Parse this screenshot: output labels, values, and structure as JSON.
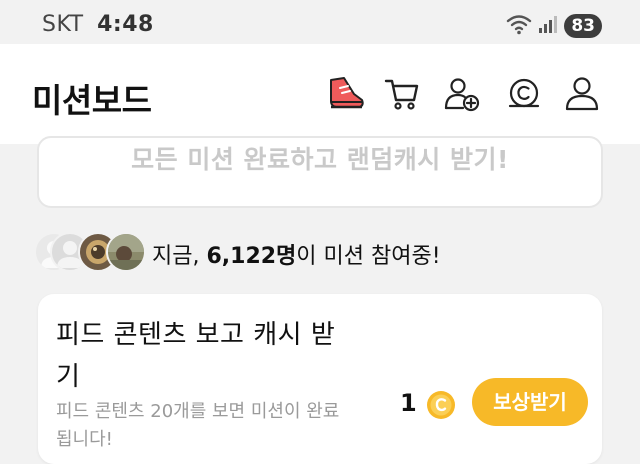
{
  "status_bar": {
    "carrier": "SKT",
    "time": "4:48",
    "battery": "83"
  },
  "header": {
    "title": "미션보드",
    "icons": [
      "sneaker-icon",
      "cart-icon",
      "add-friend-icon",
      "coin-icon",
      "profile-icon"
    ]
  },
  "banner": {
    "text": "모든 미션 완료하고 랜덤캐시 받기!"
  },
  "participants": {
    "prefix": "지금, ",
    "count": "6,122명",
    "suffix": "이 미션 참여중!"
  },
  "mission": {
    "title": "피드 콘텐츠 보고 캐시 받기",
    "description": "피드 콘텐츠 20개를 보면 미션이 완료됩니다!",
    "reward_count": "1",
    "reward_button_label": "보상받기"
  },
  "colors": {
    "accent": "#f7b928",
    "sneaker": "#ef5b5b",
    "background": "#f2f2f2"
  }
}
